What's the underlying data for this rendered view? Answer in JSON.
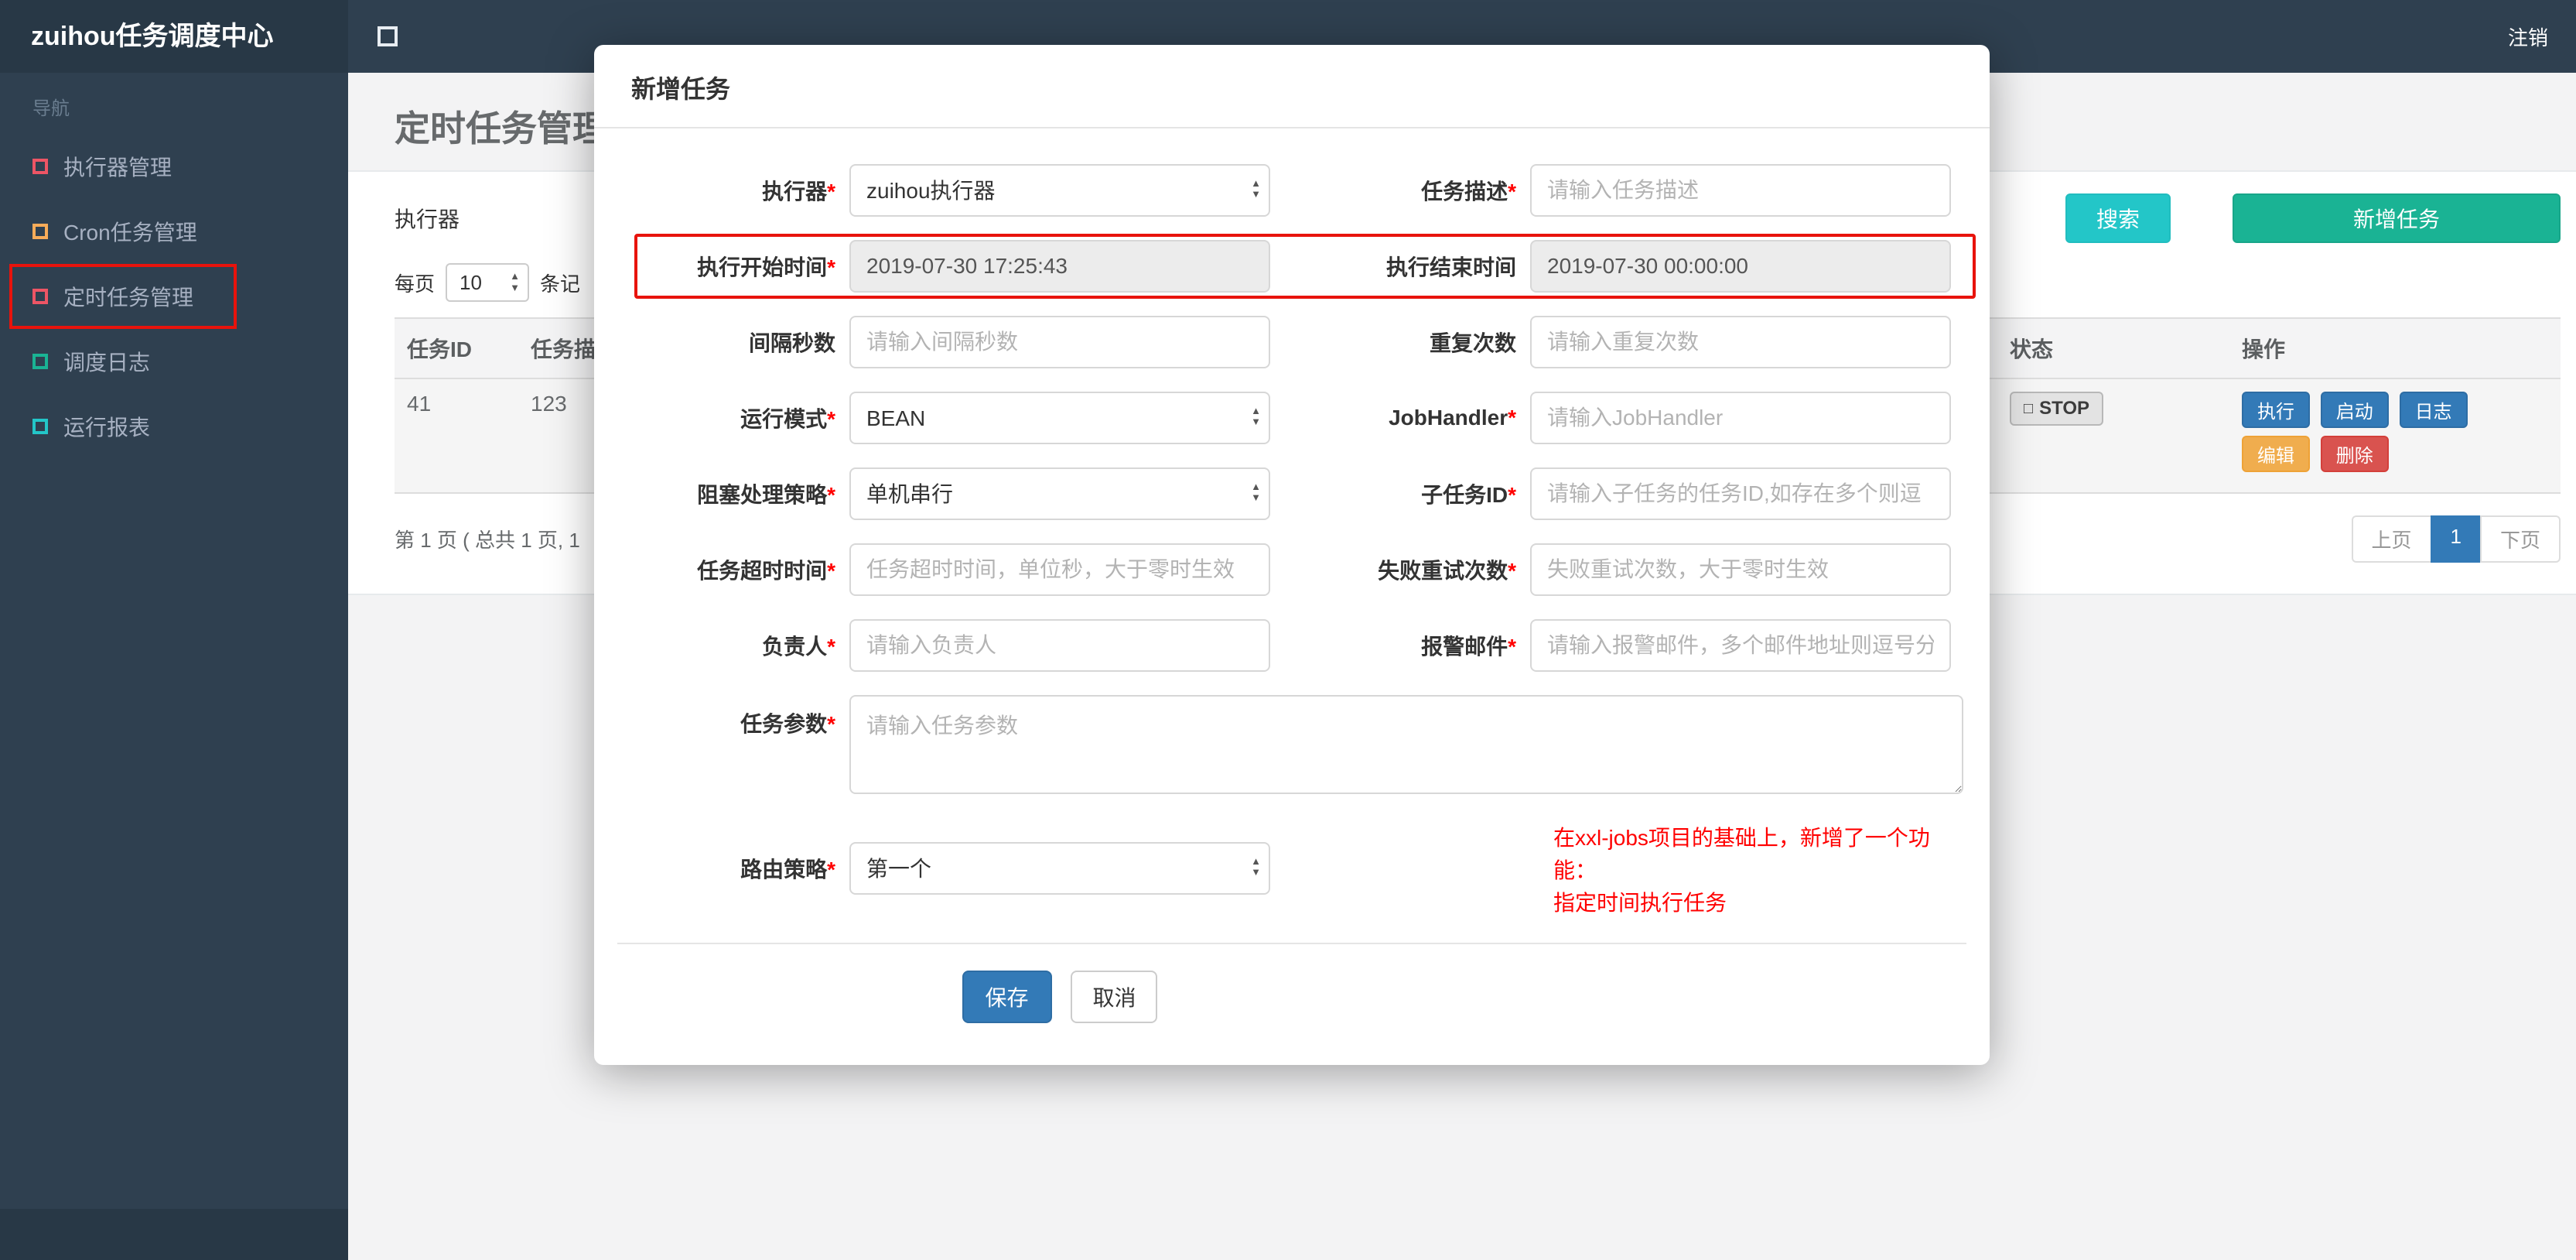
{
  "topbar": {
    "brand": "zuihou任务调度中心",
    "logout": "注销"
  },
  "sidebar": {
    "nav_label": "导航",
    "items": [
      {
        "label": "执行器管理",
        "icon_color": "#ed5565"
      },
      {
        "label": "Cron任务管理",
        "icon_color": "#f8ac59"
      },
      {
        "label": "定时任务管理",
        "icon_color": "#ed5565",
        "annotated": true
      },
      {
        "label": "调度日志",
        "icon_color": "#1ab394"
      },
      {
        "label": "运行报表",
        "icon_color": "#23c6c8"
      }
    ]
  },
  "page": {
    "title": "定时任务管理",
    "filter": {
      "executor_label": "执行器",
      "search_button": "搜索",
      "add_button": "新增任务"
    },
    "perpage": {
      "prefix": "每页",
      "value": "10",
      "suffix": "条记"
    },
    "table": {
      "headers": {
        "id": "任务ID",
        "desc": "任务描述",
        "status": "状态",
        "action": "操作"
      },
      "row": {
        "id": "41",
        "desc": "123",
        "status_icon": "□",
        "status": "STOP",
        "btn_exec": "执行",
        "btn_start": "启动",
        "btn_log": "日志",
        "btn_edit": "编辑",
        "btn_delete": "删除"
      }
    },
    "pagination": {
      "summary": "第 1 页 ( 总共 1 页, 1",
      "prev": "上页",
      "current": "1",
      "next": "下页"
    }
  },
  "modal": {
    "title": "新增任务",
    "rows": [
      {
        "l_label": "执行器",
        "l_req": "*",
        "l_value": "zuihou执行器",
        "r_label": "任务描述",
        "r_req": "*",
        "r_placeholder": "请输入任务描述"
      },
      {
        "l_label": "执行开始时间",
        "l_req": "*",
        "l_value": "2019-07-30 17:25:43",
        "r_label": "执行结束时间",
        "r_value": "2019-07-30 00:00:00"
      },
      {
        "l_label": "间隔秒数",
        "l_placeholder": "请输入间隔秒数",
        "r_label": "重复次数",
        "r_placeholder": "请输入重复次数"
      },
      {
        "l_label": "运行模式",
        "l_req": "*",
        "l_value": "BEAN",
        "r_label": "JobHandler",
        "r_req": "*",
        "r_placeholder": "请输入JobHandler"
      },
      {
        "l_label": "阻塞处理策略",
        "l_req": "*",
        "l_value": "单机串行",
        "r_label": "子任务ID",
        "r_req": "*",
        "r_placeholder": "请输入子任务的任务ID,如存在多个则逗"
      },
      {
        "l_label": "任务超时时间",
        "l_req": "*",
        "l_placeholder": "任务超时时间，单位秒，大于零时生效",
        "r_label": "失败重试次数",
        "r_req": "*",
        "r_placeholder": "失败重试次数，大于零时生效"
      },
      {
        "l_label": "负责人",
        "l_req": "*",
        "l_placeholder": "请输入负责人",
        "r_label": "报警邮件",
        "r_req": "*",
        "r_placeholder": "请输入报警邮件，多个邮件地址则逗号分"
      }
    ],
    "params": {
      "label": "任务参数",
      "req": "*",
      "placeholder": "请输入任务参数"
    },
    "route": {
      "label": "路由策略",
      "req": "*",
      "value": "第一个",
      "note_line1": "在xxl-jobs项目的基础上，新增了一个功能：",
      "note_line2": "指定时间执行任务"
    },
    "save_button": "保存",
    "cancel_button": "取消"
  },
  "annotations": {
    "color": "#e8130c"
  },
  "colors": {
    "topbar_bg": "#2f4050",
    "sidebar_bg": "#2f4050",
    "content_bg": "#f3f3f4",
    "search_button": "#23c6c8",
    "add_button": "#1ab394",
    "primary_button": "#337ab7",
    "edit_button": "#f0ad4e",
    "delete_button": "#d9534f",
    "note_text": "#ff0000"
  }
}
